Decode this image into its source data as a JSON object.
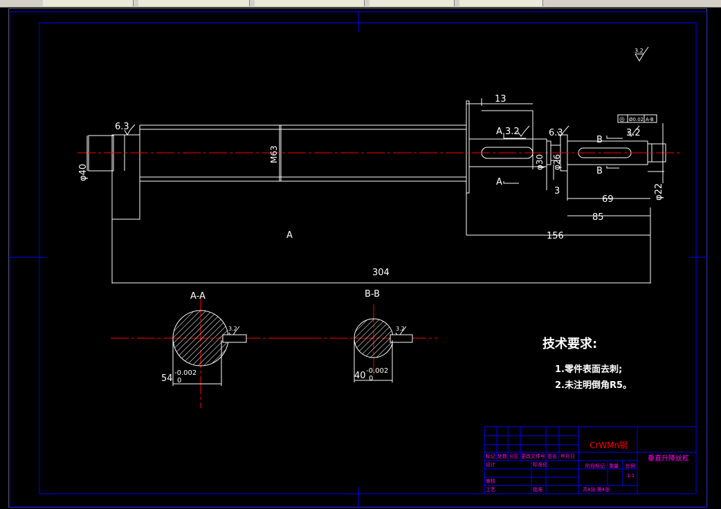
{
  "drawing": {
    "dims": {
      "d13": "13",
      "d6_3_left": "6.3",
      "d_phi40": "φ40",
      "d_M63": "M63",
      "d_A32": "A 3.2",
      "d_phi30": "φ30",
      "d_phi26": "φ26",
      "d_3": "3",
      "d6_3_right": "6.3",
      "d_B_top": "B",
      "d3_2_right": "3.2",
      "d_B_bottom": "B",
      "d_phi22": "φ22",
      "d_69": "69",
      "d_85": "85",
      "d_156": "156",
      "d_304": "304",
      "d_A_bottom": "A",
      "d_A_center": "A",
      "d_corner_32": "3.2"
    },
    "tolerance_frame": {
      "symbol": "◎",
      "value": "Ø0.02",
      "datum": "A-B"
    },
    "sections": {
      "aa_title": "A-A",
      "aa_dim": "54",
      "aa_tol_upper": "-0.002",
      "aa_tol_lower": "0",
      "aa_rough": "3.2",
      "bb_title": "B-B",
      "bb_dim": "40",
      "bb_tol_upper": "-0.002",
      "bb_tol_lower": "0",
      "bb_rough": "3.2"
    },
    "notes": {
      "title": "技术要求:",
      "line1": "1.零件表面去刺;",
      "line2": "2.未注明倒角R5。"
    },
    "title_block": {
      "material": "CrWMn钢",
      "part_name": "垂直升降丝杠",
      "r1": [
        "标记",
        "处数",
        "分区",
        "更改文件号",
        "签名",
        "年月日"
      ],
      "design": "设计",
      "standard": "标准化",
      "stage_mark": "阶段标记",
      "weight": "重量",
      "scale": "比例",
      "scale_val": "1:1",
      "review": "审核",
      "process": "工艺",
      "approve": "批准",
      "sheets": "共4张 第4张"
    },
    "colors": {
      "frame": "#0000ff",
      "line": "#ffffff",
      "center": "#ff0000",
      "title_text": "#ff00ff"
    }
  }
}
